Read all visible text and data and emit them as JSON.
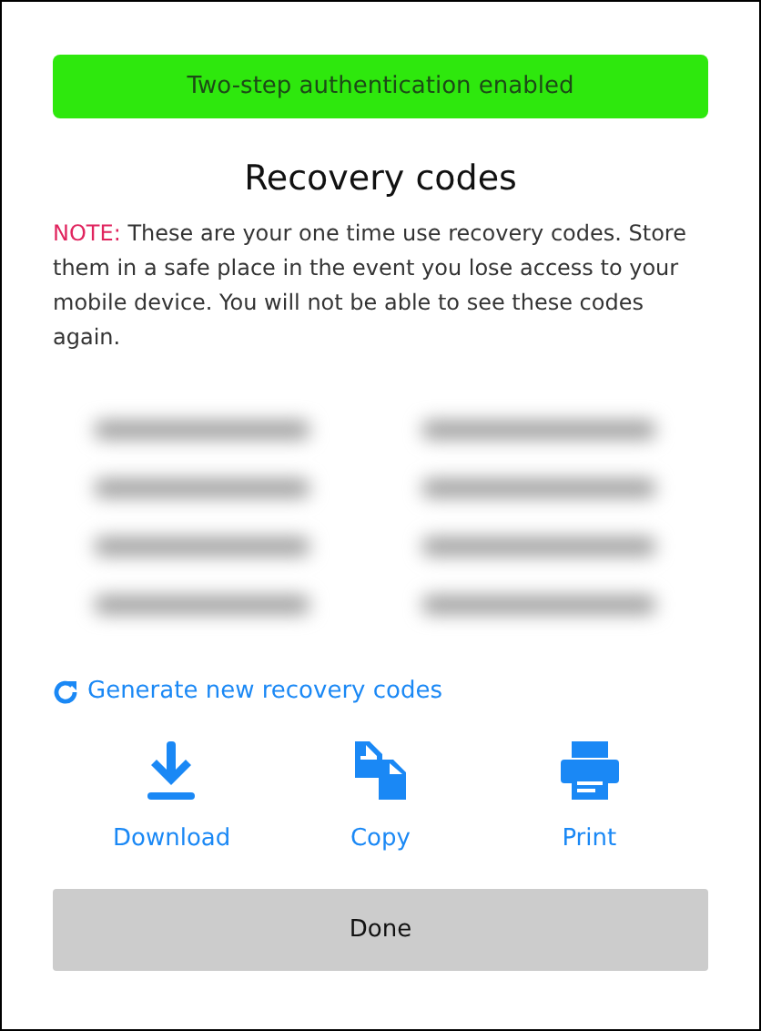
{
  "banner": {
    "text": "Two-step authentication enabled"
  },
  "title": "Recovery codes",
  "note": {
    "label": "NOTE:",
    "text": " These are your one time use recovery codes. Store them in a safe place in the event you lose access to your mobile device. You will not be able to see these codes again."
  },
  "codes": {
    "kind": "blurred"
  },
  "regenerate_link": "Generate new recovery codes",
  "actions": [
    {
      "kind": "download",
      "label": "Download"
    },
    {
      "kind": "copy",
      "label": "Copy"
    },
    {
      "kind": "print",
      "label": "Print"
    }
  ],
  "done_button": "Done"
}
